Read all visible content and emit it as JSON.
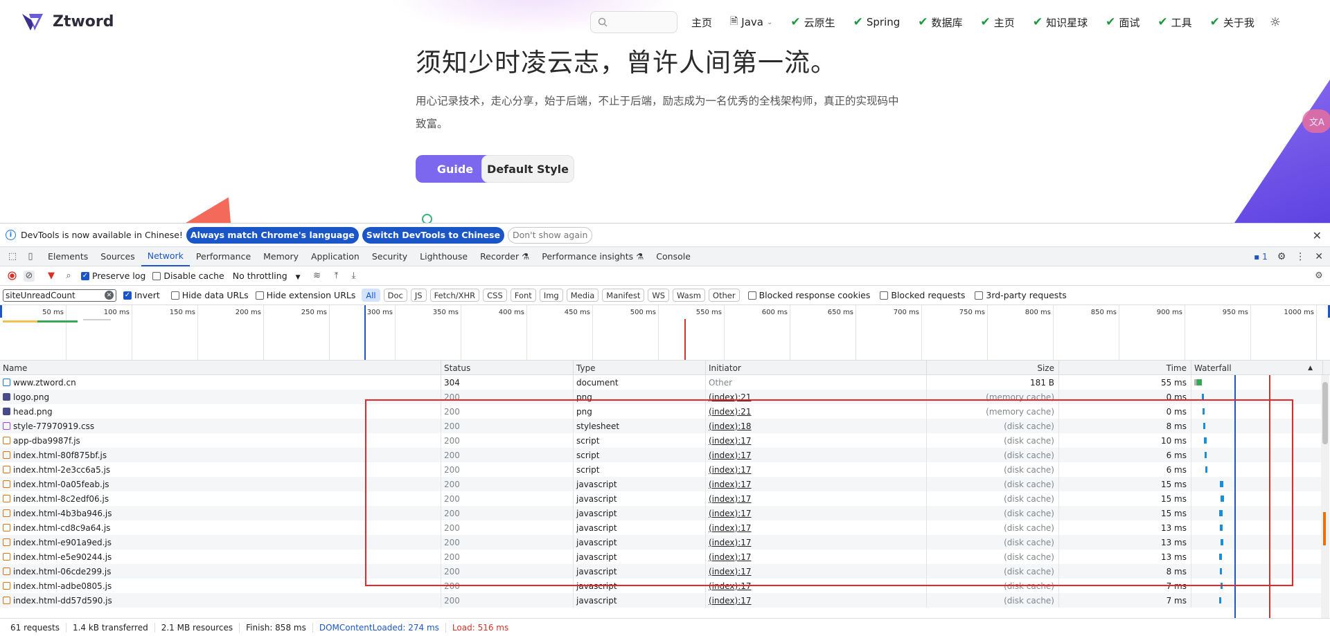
{
  "site": {
    "brand_name": "Ztword",
    "nav": {
      "items": [
        {
          "label": "主页",
          "icon": "",
          "caret": false
        },
        {
          "label": "Java",
          "icon": "document-icon",
          "caret": true
        },
        {
          "label": "云原生",
          "icon": "check-icon",
          "caret": false
        },
        {
          "label": "Spring",
          "icon": "check-icon",
          "caret": false
        },
        {
          "label": "数据库",
          "icon": "check-icon",
          "caret": false
        },
        {
          "label": "主页",
          "icon": "check-icon",
          "caret": false
        },
        {
          "label": "知识星球",
          "icon": "check-icon",
          "caret": false
        },
        {
          "label": "面试",
          "icon": "check-icon",
          "caret": false
        },
        {
          "label": "工具",
          "icon": "check-icon",
          "caret": false
        },
        {
          "label": "关于我",
          "icon": "check-icon",
          "caret": false
        }
      ]
    },
    "hero": {
      "title": "须知少时凌云志，曾许人间第一流。",
      "description": "用心记录技术，走心分享，始于后端，不止于后端，励志成为一名优秀的全栈架构师，真正的实现码中致富。",
      "primary_button": "Guide",
      "secondary_button": "Default Style"
    },
    "translate_label": "文A",
    "colors": {
      "accent": "#7b68ee",
      "check": "#1a9a3c"
    }
  },
  "devtools": {
    "infobar": {
      "message": "DevTools is now available in Chinese!",
      "btn_match": "Always match Chrome's language",
      "btn_switch": "Switch DevTools to Chinese",
      "btn_dismiss": "Don't show again"
    },
    "tabs": [
      "Elements",
      "Sources",
      "Network",
      "Performance",
      "Memory",
      "Application",
      "Security",
      "Lighthouse",
      "Recorder ⚗",
      "Performance insights ⚗",
      "Console"
    ],
    "active_tab": "Network",
    "issues_count": "1",
    "toolbar": {
      "preserve_log": "Preserve log",
      "disable_cache": "Disable cache",
      "throttling": "No throttling"
    },
    "filter": {
      "value": "siteUnreadCount",
      "invert": "Invert",
      "hide_data_urls": "Hide data URLs",
      "hide_extension_urls": "Hide extension URLs",
      "types": [
        "All",
        "Doc",
        "JS",
        "Fetch/XHR",
        "CSS",
        "Font",
        "Img",
        "Media",
        "Manifest",
        "WS",
        "Wasm",
        "Other"
      ],
      "active_type": "All",
      "blocked_response_cookies": "Blocked response cookies",
      "blocked_requests": "Blocked requests",
      "third_party": "3rd-party requests"
    },
    "overview_ticks": [
      "50 ms",
      "100 ms",
      "150 ms",
      "200 ms",
      "250 ms",
      "300 ms",
      "350 ms",
      "400 ms",
      "450 ms",
      "500 ms",
      "550 ms",
      "600 ms",
      "650 ms",
      "700 ms",
      "750 ms",
      "800 ms",
      "850 ms",
      "900 ms",
      "950 ms",
      "1000 ms"
    ],
    "columns": [
      "Name",
      "Status",
      "Type",
      "Initiator",
      "Size",
      "Time",
      "Waterfall"
    ],
    "rows": [
      {
        "name": "www.ztword.cn",
        "icon": "doc",
        "status": "304",
        "type": "document",
        "initiator": "Other",
        "size": "181 B",
        "time": "55 ms"
      },
      {
        "name": "logo.png",
        "icon": "img",
        "status": "200",
        "type": "png",
        "initiator": "(index):21",
        "size": "(memory cache)",
        "time": "0 ms"
      },
      {
        "name": "head.png",
        "icon": "img",
        "status": "200",
        "type": "png",
        "initiator": "(index):21",
        "size": "(memory cache)",
        "time": "0 ms"
      },
      {
        "name": "style-77970919.css",
        "icon": "css",
        "status": "200",
        "type": "stylesheet",
        "initiator": "(index):18",
        "size": "(disk cache)",
        "time": "8 ms"
      },
      {
        "name": "app-dba9987f.js",
        "icon": "js",
        "status": "200",
        "type": "script",
        "initiator": "(index):17",
        "size": "(disk cache)",
        "time": "10 ms"
      },
      {
        "name": "index.html-80f875bf.js",
        "icon": "js",
        "status": "200",
        "type": "script",
        "initiator": "(index):17",
        "size": "(disk cache)",
        "time": "6 ms"
      },
      {
        "name": "index.html-2e3cc6a5.js",
        "icon": "js",
        "status": "200",
        "type": "script",
        "initiator": "(index):17",
        "size": "(disk cache)",
        "time": "6 ms"
      },
      {
        "name": "index.html-0a05feab.js",
        "icon": "js",
        "status": "200",
        "type": "javascript",
        "initiator": "(index):17",
        "size": "(disk cache)",
        "time": "15 ms"
      },
      {
        "name": "index.html-8c2edf06.js",
        "icon": "js",
        "status": "200",
        "type": "javascript",
        "initiator": "(index):17",
        "size": "(disk cache)",
        "time": "15 ms"
      },
      {
        "name": "index.html-4b3ba946.js",
        "icon": "js",
        "status": "200",
        "type": "javascript",
        "initiator": "(index):17",
        "size": "(disk cache)",
        "time": "15 ms"
      },
      {
        "name": "index.html-cd8c9a64.js",
        "icon": "js",
        "status": "200",
        "type": "javascript",
        "initiator": "(index):17",
        "size": "(disk cache)",
        "time": "13 ms"
      },
      {
        "name": "index.html-e901a9ed.js",
        "icon": "js",
        "status": "200",
        "type": "javascript",
        "initiator": "(index):17",
        "size": "(disk cache)",
        "time": "13 ms"
      },
      {
        "name": "index.html-e5e90244.js",
        "icon": "js",
        "status": "200",
        "type": "javascript",
        "initiator": "(index):17",
        "size": "(disk cache)",
        "time": "13 ms"
      },
      {
        "name": "index.html-06cde299.js",
        "icon": "js",
        "status": "200",
        "type": "javascript",
        "initiator": "(index):17",
        "size": "(disk cache)",
        "time": "8 ms"
      },
      {
        "name": "index.html-adbe0805.js",
        "icon": "js",
        "status": "200",
        "type": "javascript",
        "initiator": "(index):17",
        "size": "(disk cache)",
        "time": "7 ms"
      },
      {
        "name": "index.html-dd57d590.js",
        "icon": "js",
        "status": "200",
        "type": "javascript",
        "initiator": "(index):17",
        "size": "(disk cache)",
        "time": "7 ms"
      }
    ],
    "status_bar": {
      "requests": "61 requests",
      "transferred": "1.4 kB transferred",
      "resources": "2.1 MB resources",
      "finish": "Finish: 858 ms",
      "dom_content_loaded": "DOMContentLoaded: 274 ms",
      "load": "Load: 516 ms"
    },
    "colors": {
      "dcl": "#1a56c7",
      "load": "#d93025",
      "highlight": "#e8262a"
    }
  }
}
